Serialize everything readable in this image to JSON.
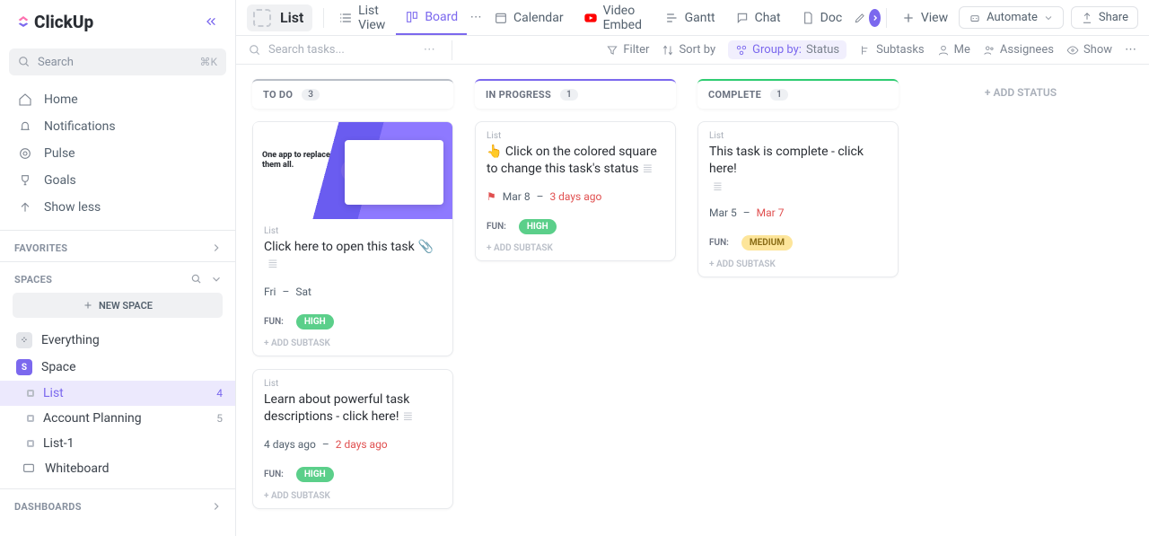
{
  "brand": "ClickUp",
  "sidebar": {
    "search_placeholder": "Search",
    "kbd": "⌘K",
    "nav": [
      "Home",
      "Notifications",
      "Pulse",
      "Goals",
      "Show less"
    ],
    "favorites_label": "FAVORITES",
    "spaces_label": "SPACES",
    "new_space": "NEW SPACE",
    "everything": "Everything",
    "space": "Space",
    "lists": [
      {
        "name": "List",
        "count": "4"
      },
      {
        "name": "Account Planning",
        "count": "5"
      },
      {
        "name": "List-1",
        "count": ""
      }
    ],
    "whiteboard": "Whiteboard",
    "dashboards_label": "DASHBOARDS"
  },
  "header": {
    "title": "List",
    "views": [
      {
        "label": "List View"
      },
      {
        "label": "Board"
      },
      {
        "label": "Calendar"
      },
      {
        "label": "Video Embed"
      },
      {
        "label": "Gantt"
      },
      {
        "label": "Chat"
      },
      {
        "label": "Doc"
      },
      {
        "label": "View"
      }
    ],
    "automate": "Automate",
    "share": "Share"
  },
  "toolbar": {
    "search_placeholder": "Search tasks...",
    "filter": "Filter",
    "sort": "Sort by",
    "group_by": "Group by:",
    "group_val": "Status",
    "subtasks": "Subtasks",
    "me": "Me",
    "assignees": "Assignees",
    "show": "Show"
  },
  "board": {
    "add_status": "+ ADD STATUS",
    "columns": [
      {
        "name": "TO DO",
        "count": "3",
        "color": "#b9bec7"
      },
      {
        "name": "IN PROGRESS",
        "count": "1",
        "color": "#7b68ee"
      },
      {
        "name": "COMPLETE",
        "count": "1",
        "color": "#2ecc71"
      }
    ]
  },
  "cards": {
    "list_label": "List",
    "fun_label": "FUN:",
    "add_subtask": "+ ADD SUBTASK",
    "thumb_text": "One app to replace them all.",
    "todo1": {
      "title": "Click here to open this task",
      "start": "Fri",
      "due": "Sat",
      "tag": "HIGH"
    },
    "todo2": {
      "title": "Learn about powerful task descrip­tions - click here!",
      "start": "4 days ago",
      "due": "2 days ago",
      "tag": "HIGH"
    },
    "prog1": {
      "title": "👆 Click on the colored square to change this task's status",
      "start": "Mar 8",
      "due": "3 days ago",
      "tag": "HIGH"
    },
    "done1": {
      "title": "This task is complete - click here!",
      "start": "Mar 5",
      "due": "Mar 7",
      "tag": "MEDIUM"
    }
  }
}
